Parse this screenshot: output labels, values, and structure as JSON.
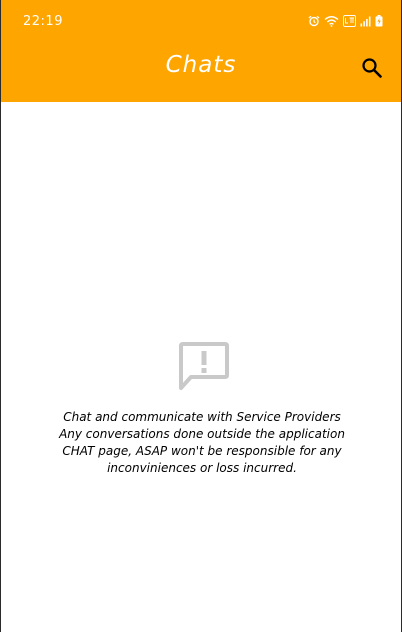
{
  "status_bar": {
    "time": "22:19",
    "icons": [
      "alarm-icon",
      "wifi-icon",
      "volte-icon",
      "signal-icon",
      "battery-icon"
    ]
  },
  "app_bar": {
    "title": "Chats",
    "background": "#FFA500",
    "action_icon": "search-icon"
  },
  "empty_state": {
    "icon": "chat-alert-icon",
    "icon_color": "#c9c9c9",
    "lines": [
      "Chat and communicate with Service Providers",
      "Any conversations done outside the application",
      "CHAT page, ASAP won't be responsible for any",
      "inconviniences or loss incurred."
    ]
  }
}
